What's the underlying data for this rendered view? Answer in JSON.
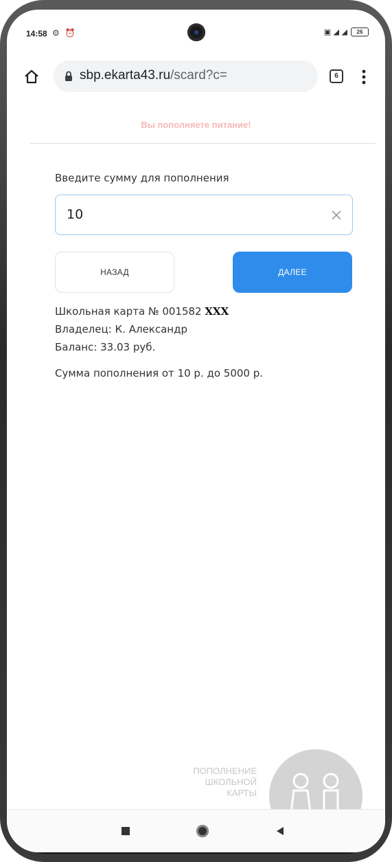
{
  "status": {
    "time": "14:58",
    "left_icons": "⚙ ⏰",
    "right_icons": "▣ ◢ ◢",
    "battery": "26"
  },
  "browser": {
    "url_host": "sbp.ekarta43.ru",
    "url_path": "/scard?c=",
    "tab_count": "6"
  },
  "page": {
    "notice": "Вы пополняете питание!",
    "amount_label": "Введите сумму для пополнения",
    "amount_value": "10",
    "back_button": "НАЗАД",
    "next_button": "ДАЛЕЕ",
    "card_prefix": "Школьная карта № 001582 ",
    "card_masked": "XXX",
    "owner": "Владелец: К. Александр",
    "balance": "Баланс: 33.03 руб.",
    "range": "Сумма пополнения от 10 р. до 5000 р.",
    "promo_line1": "ПОПОЛНЕНИЕ",
    "promo_line2": "ШКОЛЬНОЙ",
    "promo_line3": "КАРТЫ"
  },
  "colors": {
    "accent": "#2f8cea",
    "notice": "#f7b8b8",
    "input_border": "#9fc6ee"
  }
}
